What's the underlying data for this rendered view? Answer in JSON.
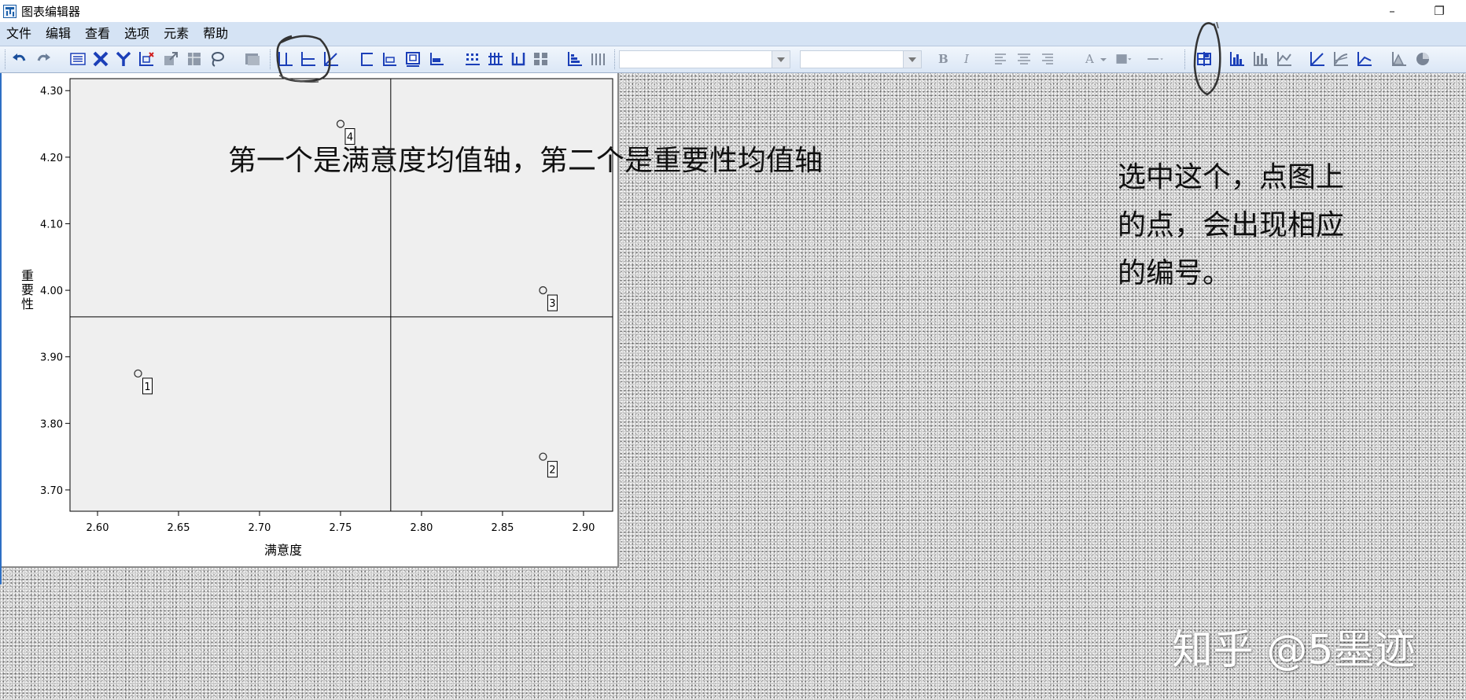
{
  "window": {
    "title": "图表编辑器",
    "minimize_symbol": "–",
    "restore_symbol": "❐"
  },
  "menu": [
    "文件",
    "编辑",
    "查看",
    "选项",
    "元素",
    "帮助"
  ],
  "toolbar": {
    "bold_label": "B",
    "italic_label": "I",
    "font_color_label": "A",
    "icons": [
      "undo-icon",
      "redo-icon",
      "properties-icon",
      "x-axis-icon",
      "y-axis-icon",
      "data-label-icon",
      "scale-icon",
      "transpose-icon",
      "lasso-icon",
      "layer-icon",
      "x-mean-line-icon",
      "y-mean-line-icon",
      "diagonal-line-icon",
      "reference-line-icon",
      "fit-line-icon",
      "annotation-icon",
      "text-box-icon",
      "footnote-icon",
      "grid-icon",
      "grid-bold-icon",
      "bar-frame-icon",
      "legend-icon",
      "sort-icon",
      "bars-icon",
      "data-label-mode-icon",
      "histogram-icon",
      "bar-chart-icon",
      "line-chart-icon",
      "scatter-icon",
      "fit-icon",
      "loess-icon",
      "area-icon",
      "pie-icon"
    ]
  },
  "colors": {
    "accent": "#1b3fb8",
    "menubar": "#d5e3f4",
    "plot_bg": "#efefef"
  },
  "chart_data": {
    "type": "scatter",
    "xlabel": "满意度",
    "ylabel": "重要性",
    "xlim": [
      2.583,
      2.918
    ],
    "ylim": [
      3.668,
      4.318
    ],
    "xticks": [
      2.6,
      2.65,
      2.7,
      2.75,
      2.8,
      2.85,
      2.9
    ],
    "xtick_labels": [
      "2.60",
      "2.65",
      "2.70",
      "2.75",
      "2.80",
      "2.85",
      "2.90"
    ],
    "yticks": [
      3.7,
      3.8,
      3.9,
      4.0,
      4.1,
      4.2,
      4.3
    ],
    "ytick_labels": [
      "3.70",
      "3.80",
      "3.90",
      "4.00",
      "4.10",
      "4.20",
      "4.30"
    ],
    "points": [
      {
        "x": 2.625,
        "y": 3.875,
        "label": "1"
      },
      {
        "x": 2.875,
        "y": 3.75,
        "label": "2"
      },
      {
        "x": 2.875,
        "y": 4.0,
        "label": "3"
      },
      {
        "x": 2.75,
        "y": 4.25,
        "label": "4"
      }
    ],
    "mean_x": 2.781,
    "mean_y": 3.96,
    "grid": false
  },
  "annotations": {
    "axes_note": "第一个是满意度均值轴，第二个是重要性均值轴",
    "select_note": "选中这个，点图上的点，会出现相应的编号。"
  },
  "watermark": "知乎 @5墨迹"
}
